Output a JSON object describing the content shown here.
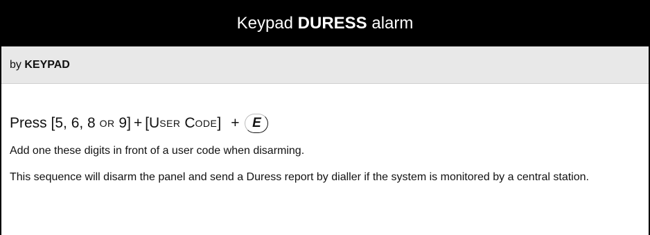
{
  "title": {
    "prefix": "Keypad ",
    "emphasis": "DURESS",
    "suffix": " alarm"
  },
  "method": {
    "prefix": "by ",
    "emphasis": "KEYPAD"
  },
  "sequence": {
    "press": "Press",
    "digits_open": "[5, 6, 8 ",
    "or": "OR",
    "digits_close": " 9]",
    "plus1": "+",
    "code_open": "[",
    "user_u": "U",
    "user_rest": "SER",
    "code_c": "C",
    "code_rest": "ODE",
    "code_close": "]",
    "plus2": "+",
    "key": "E"
  },
  "paragraphs": [
    "Add one these digits in front of a user code when disarming.",
    "This sequence will disarm the panel and send a Duress report by dialler if the system is monitored by a central station."
  ]
}
